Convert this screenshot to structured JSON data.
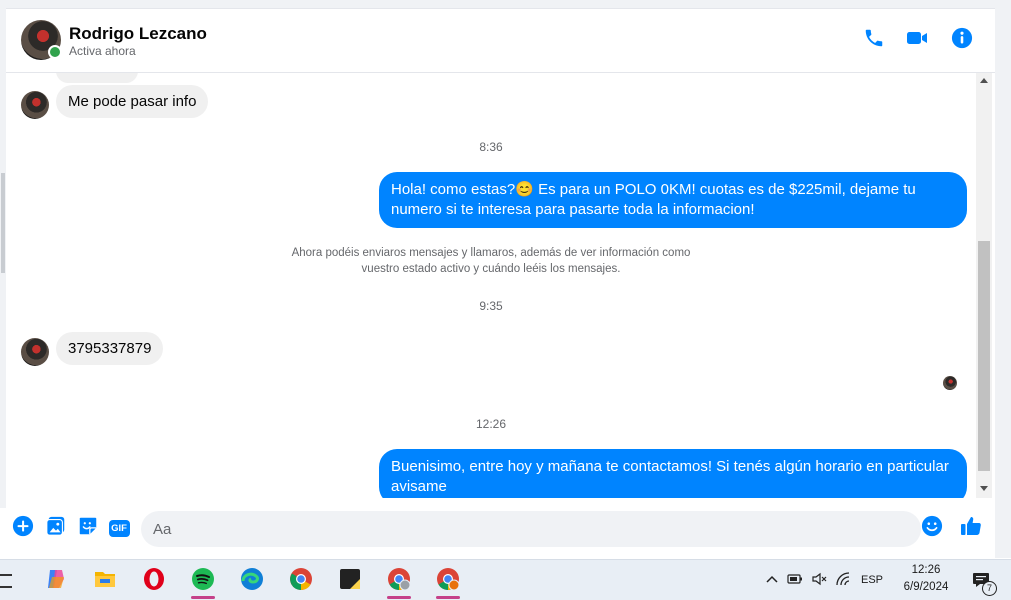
{
  "header": {
    "contact_name": "Rodrigo Lezcano",
    "status": "Activa ahora",
    "icons": [
      "phone-icon",
      "video-icon",
      "info-icon"
    ]
  },
  "messages": [
    {
      "type": "incoming",
      "text": "Me pode pasar info"
    },
    {
      "type": "time",
      "text": "8:36"
    },
    {
      "type": "outgoing",
      "lines": [
        "Hola! como estas?😊 Es para un POLO 0KM! cuotas es de $225mil, dejame tu",
        "numero si te interesa para pasarte toda la informacion!"
      ]
    },
    {
      "type": "system",
      "lines": [
        "Ahora podéis enviaros mensajes y llamaros, además de ver información como",
        "vuestro estado activo y cuándo leéis los mensajes."
      ]
    },
    {
      "type": "time",
      "text": "9:35"
    },
    {
      "type": "incoming",
      "text": "3795337879"
    },
    {
      "type": "time",
      "text": "12:26"
    },
    {
      "type": "outgoing",
      "lines": [
        "Buenisimo, entre hoy y mañana te contactamos! Si tenés algún horario en particular",
        "avisame"
      ]
    }
  ],
  "composer": {
    "placeholder": "Aa",
    "icons": [
      "plus-icon",
      "image-icon",
      "sticker-icon",
      "gif-icon",
      "emoji-icon",
      "like-icon"
    ],
    "gif_label": "GIF"
  },
  "taskbar": {
    "apps": [
      "copilot-icon",
      "file-explorer-icon",
      "opera-icon",
      "spotify-icon",
      "edge-icon",
      "chrome-icon",
      "sticky-notes-icon",
      "chrome-profile-icon",
      "chrome-alt-icon"
    ],
    "language": "ESP",
    "time": "12:26",
    "date": "6/9/2024",
    "notification_count": "7"
  },
  "colors": {
    "accent": "#0084ff",
    "incoming_bubble": "#f0f0f0",
    "online": "#31a24c"
  }
}
